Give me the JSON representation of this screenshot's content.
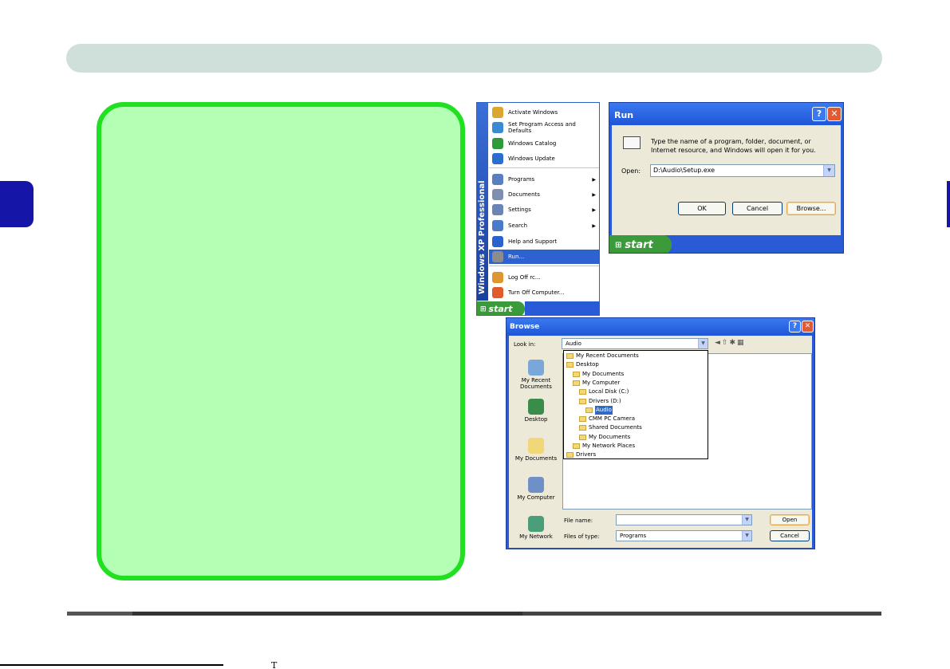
{
  "start_menu": {
    "strip_text": "Windows XP Professional",
    "items": [
      {
        "label": "Activate Windows",
        "icon": "key-icon",
        "color": "#d9a62e"
      },
      {
        "label": "Set Program Access and Defaults",
        "icon": "program-access-icon",
        "color": "#3a8bd6"
      },
      {
        "label": "Windows Catalog",
        "icon": "windows-catalog-icon",
        "color": "#2e9a3a"
      },
      {
        "label": "Windows Update",
        "icon": "windows-update-icon",
        "color": "#2a6fcf"
      },
      {
        "label": "Programs",
        "icon": "programs-icon",
        "color": "#5a7fbf",
        "submenu": true
      },
      {
        "label": "Documents",
        "icon": "documents-icon",
        "color": "#7f8fb0",
        "submenu": true
      },
      {
        "label": "Settings",
        "icon": "settings-icon",
        "color": "#6a84b8",
        "submenu": true
      },
      {
        "label": "Search",
        "icon": "search-icon",
        "color": "#4b7bc8",
        "submenu": true
      },
      {
        "label": "Help and Support",
        "icon": "help-icon",
        "color": "#2a62d0"
      },
      {
        "label": "Run...",
        "icon": "run-icon",
        "color": "#8c8c8c",
        "highlighted": true
      },
      {
        "label": "Log Off rc...",
        "icon": "log-off-icon",
        "color": "#e0962e"
      },
      {
        "label": "Turn Off Computer...",
        "icon": "power-icon",
        "color": "#e05a2a"
      }
    ],
    "start_label": "start"
  },
  "run_dialog": {
    "title": "Run",
    "help": "?",
    "close": "✕",
    "description": "Type the name of a program, folder, document, or Internet resource, and Windows will open it for you.",
    "open_label": "Open:",
    "open_value": "D:\\Audio\\Setup.exe",
    "ok": "OK",
    "cancel": "Cancel",
    "browse": "Browse...",
    "start_label": "start"
  },
  "browse_dialog": {
    "title": "Browse",
    "look_in_label": "Look in:",
    "look_in_value": "Audio",
    "places": [
      "My Recent Documents",
      "Desktop",
      "My Documents",
      "My Computer",
      "My Network"
    ],
    "dropdown": [
      {
        "label": "My Recent Documents",
        "indent": 0
      },
      {
        "label": "Desktop",
        "indent": 0
      },
      {
        "label": "My Documents",
        "indent": 1
      },
      {
        "label": "My Computer",
        "indent": 1
      },
      {
        "label": "Local Disk (C:)",
        "indent": 2
      },
      {
        "label": "Drivers (D:)",
        "indent": 2
      },
      {
        "label": "Audio",
        "indent": 3,
        "selected": true
      },
      {
        "label": "CMM PC Camera",
        "indent": 2
      },
      {
        "label": "Shared Documents",
        "indent": 2
      },
      {
        "label": "My Documents",
        "indent": 2
      },
      {
        "label": "My Network Places",
        "indent": 1
      },
      {
        "label": "Drivers",
        "indent": 0
      }
    ],
    "file_name_label": "File name:",
    "file_name_value": "",
    "files_type_label": "Files of type:",
    "files_type_value": "Programs",
    "open": "Open",
    "cancel": "Cancel"
  },
  "footer": {
    "glyph": "T"
  }
}
